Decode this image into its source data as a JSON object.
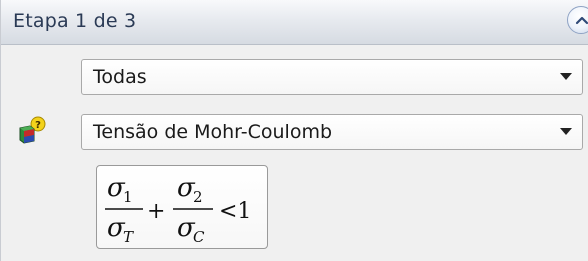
{
  "header": {
    "title": "Etapa 1 de 3"
  },
  "controls": {
    "scope_select": {
      "value": "Todas"
    },
    "criterion_select": {
      "value": "Tensão de Mohr-Coulomb"
    }
  },
  "formula": {
    "numerator1": "σ",
    "numerator1_sub": "1",
    "denominator1": "σ",
    "denominator1_sub": "T",
    "plus": "+",
    "numerator2": "σ",
    "numerator2_sub": "2",
    "denominator2": "σ",
    "denominator2_sub": "C",
    "comparison": "<1"
  },
  "icons": {
    "collapse": "chevron-up-icon",
    "criterion": "failure-criterion-icon",
    "dropdown": "chevron-down-icon"
  },
  "colors": {
    "header_text": "#2a3a55",
    "panel_background": "#f0f0f0"
  }
}
